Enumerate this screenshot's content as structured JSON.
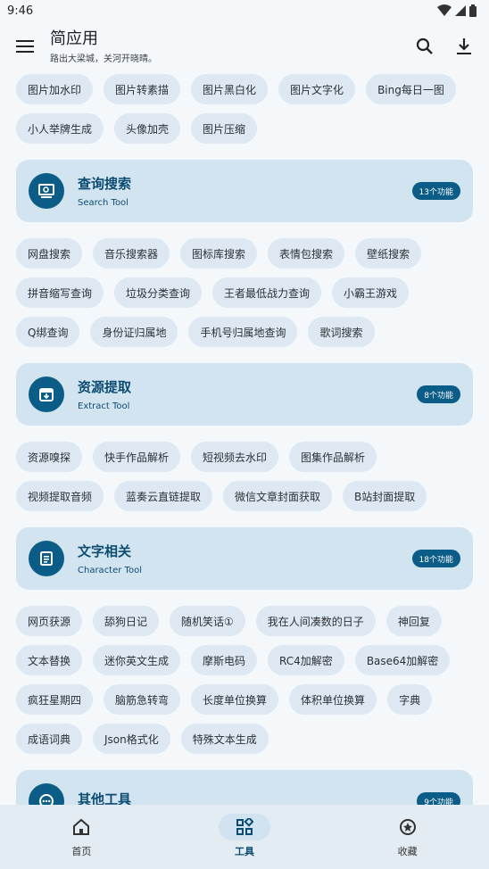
{
  "status": {
    "time": "9:46"
  },
  "header": {
    "title": "简应用",
    "subtitle": "路出大梁城，关河开晓晴。"
  },
  "image_tools": [
    "图片加水印",
    "图片转素描",
    "图片黑白化",
    "图片文字化",
    "Bing每日一图",
    "小人举牌生成",
    "头像加壳",
    "图片压缩"
  ],
  "sections": [
    {
      "title": "查询搜索",
      "subtitle": "Search Tool",
      "badge": "13个功能",
      "icon": "search-monitor-icon",
      "items": [
        "网盘搜索",
        "音乐搜索器",
        "图标库搜索",
        "表情包搜索",
        "壁纸搜索",
        "拼音缩写查询",
        "垃圾分类查询",
        "王者最低战力查询",
        "小霸王游戏",
        "Q绑查询",
        "身份证归属地",
        "手机号归属地查询",
        "歌词搜索"
      ]
    },
    {
      "title": "资源提取",
      "subtitle": "Extract Tool",
      "badge": "8个功能",
      "icon": "archive-icon",
      "items": [
        "资源嗅探",
        "快手作品解析",
        "短视频去水印",
        "图集作品解析",
        "视频提取音频",
        "蓝奏云直链提取",
        "微信文章封面获取",
        "B站封面提取"
      ]
    },
    {
      "title": "文字相关",
      "subtitle": "Character Tool",
      "badge": "18个功能",
      "icon": "document-icon",
      "items": [
        "网页获源",
        "舔狗日记",
        "随机笑话①",
        "我在人间凑数的日子",
        "神回复",
        "文本替换",
        "迷你英文生成",
        "摩斯电码",
        "RC4加解密",
        "Base64加解密",
        "疯狂星期四",
        "脑筋急转弯",
        "长度单位换算",
        "体积单位换算",
        "字典",
        "成语词典",
        "Json格式化",
        "特殊文本生成"
      ]
    },
    {
      "title": "其他工具",
      "subtitle": "",
      "badge": "9个功能",
      "icon": "more-icon",
      "items": []
    }
  ],
  "nav": {
    "home": "首页",
    "tools": "工具",
    "favorites": "收藏"
  },
  "colors": {
    "accent": "#0b5d87",
    "card": "#d3e4f1",
    "chip": "#dde8f2"
  }
}
